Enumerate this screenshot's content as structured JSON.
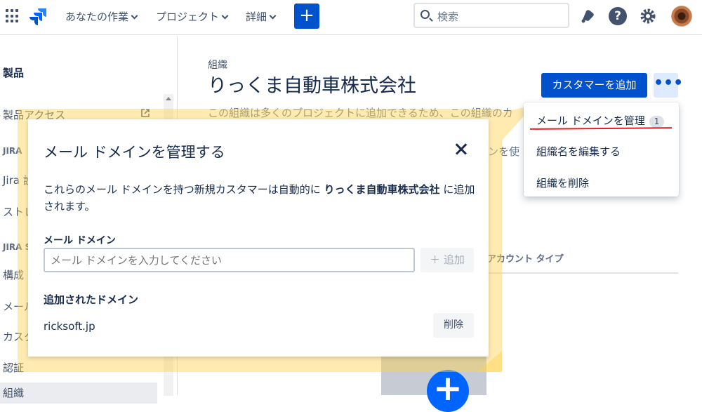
{
  "topbar": {
    "nav": [
      "あなたの作業",
      "プロジェクト",
      "詳細"
    ],
    "create_label": "+",
    "search_placeholder": "検索",
    "help_label": "?"
  },
  "sidebar": {
    "section_title": "製品",
    "items": [
      "製品アクセス",
      "Jira 設",
      "ストレ",
      "構成",
      "メール",
      "カスタ",
      "認証",
      "組織"
    ],
    "headers": [
      "JIRA",
      "JIRA SE"
    ]
  },
  "main": {
    "subtitle": "組織",
    "title": "りっくま自動車株式会社",
    "add_customer_label": "カスタマーを追加",
    "more_label": "•••",
    "description": "この組織は多くのプロジェクトに追加できるため、この組織のカ",
    "description2": "インを使",
    "column_header": "アカウント タイプ"
  },
  "dropdown": {
    "items": [
      {
        "label": "メール ドメインを管理",
        "badge": "1"
      },
      {
        "label": "組織名を編集する"
      },
      {
        "label": "組織を削除"
      }
    ]
  },
  "modal": {
    "title": "メール ドメインを管理する",
    "body_prefix": "これらのメール ドメインを持つ新規カスタマーは自動的に ",
    "body_org": "りっくま自動車株式会社",
    "body_suffix": " に追加されます。",
    "domain_label": "メール ドメイン",
    "input_placeholder": "メール ドメインを入力してください",
    "add_label": "＋ 追加",
    "added_label": "追加されたドメイン",
    "domains": [
      "ricksoft.jp"
    ],
    "delete_label": "削除"
  },
  "colors": {
    "primary": "#0052cc",
    "highlight": "#ffd350",
    "annotation_red": "#e02020"
  }
}
